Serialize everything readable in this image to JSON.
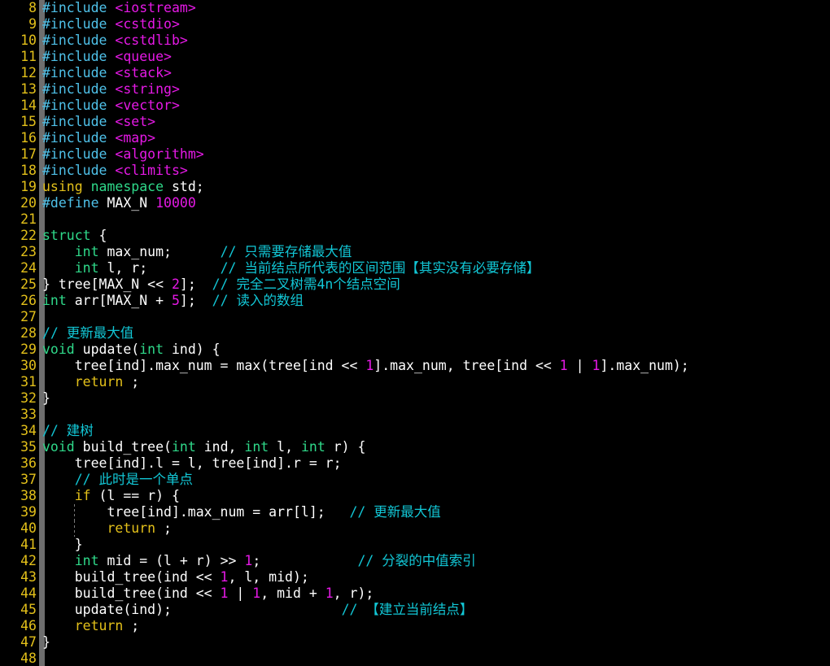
{
  "editor": {
    "title": "segment-tree-source",
    "language": "C++",
    "first_visible_line": 8,
    "last_visible_line": 48,
    "line_height_px": 20,
    "colors": {
      "background": "#000000",
      "gutter_bar": "#6e6e6e",
      "line_number": "#e3c01a",
      "preprocessor": "#4fc1e9",
      "header_name": "#e619e6",
      "keyword": "#e3c01a",
      "type": "#2fd98a",
      "number": "#e619e6",
      "comment": "#12c7d6",
      "plain_text": "#ffffff",
      "indent_guide": "#7a7a7a"
    }
  },
  "lines": [
    {
      "n": "8",
      "indent_guides": [],
      "tokens": [
        {
          "c": "t-pre",
          "t": "#include"
        },
        {
          "c": "t-plain",
          "t": " "
        },
        {
          "c": "t-hdr",
          "t": "<iostream>"
        }
      ]
    },
    {
      "n": "9",
      "indent_guides": [],
      "tokens": [
        {
          "c": "t-pre",
          "t": "#include"
        },
        {
          "c": "t-plain",
          "t": " "
        },
        {
          "c": "t-hdr",
          "t": "<cstdio>"
        }
      ]
    },
    {
      "n": "10",
      "indent_guides": [],
      "tokens": [
        {
          "c": "t-pre",
          "t": "#include"
        },
        {
          "c": "t-plain",
          "t": " "
        },
        {
          "c": "t-hdr",
          "t": "<cstdlib>"
        }
      ]
    },
    {
      "n": "11",
      "indent_guides": [],
      "tokens": [
        {
          "c": "t-pre",
          "t": "#include"
        },
        {
          "c": "t-plain",
          "t": " "
        },
        {
          "c": "t-hdr",
          "t": "<queue>"
        }
      ]
    },
    {
      "n": "12",
      "indent_guides": [],
      "tokens": [
        {
          "c": "t-pre",
          "t": "#include"
        },
        {
          "c": "t-plain",
          "t": " "
        },
        {
          "c": "t-hdr",
          "t": "<stack>"
        }
      ]
    },
    {
      "n": "13",
      "indent_guides": [],
      "tokens": [
        {
          "c": "t-pre",
          "t": "#include"
        },
        {
          "c": "t-plain",
          "t": " "
        },
        {
          "c": "t-hdr",
          "t": "<string>"
        }
      ]
    },
    {
      "n": "14",
      "indent_guides": [],
      "tokens": [
        {
          "c": "t-pre",
          "t": "#include"
        },
        {
          "c": "t-plain",
          "t": " "
        },
        {
          "c": "t-hdr",
          "t": "<vector>"
        }
      ]
    },
    {
      "n": "15",
      "indent_guides": [],
      "tokens": [
        {
          "c": "t-pre",
          "t": "#include"
        },
        {
          "c": "t-plain",
          "t": " "
        },
        {
          "c": "t-hdr",
          "t": "<set>"
        }
      ]
    },
    {
      "n": "16",
      "indent_guides": [],
      "tokens": [
        {
          "c": "t-pre",
          "t": "#include"
        },
        {
          "c": "t-plain",
          "t": " "
        },
        {
          "c": "t-hdr",
          "t": "<map>"
        }
      ]
    },
    {
      "n": "17",
      "indent_guides": [],
      "tokens": [
        {
          "c": "t-pre",
          "t": "#include"
        },
        {
          "c": "t-plain",
          "t": " "
        },
        {
          "c": "t-hdr",
          "t": "<algorithm>"
        }
      ]
    },
    {
      "n": "18",
      "indent_guides": [],
      "tokens": [
        {
          "c": "t-pre",
          "t": "#include"
        },
        {
          "c": "t-plain",
          "t": " "
        },
        {
          "c": "t-hdr",
          "t": "<climits>"
        }
      ]
    },
    {
      "n": "19",
      "indent_guides": [],
      "tokens": [
        {
          "c": "t-kw",
          "t": "using"
        },
        {
          "c": "t-plain",
          "t": " "
        },
        {
          "c": "t-type",
          "t": "namespace"
        },
        {
          "c": "t-plain",
          "t": " std;"
        }
      ]
    },
    {
      "n": "20",
      "indent_guides": [],
      "tokens": [
        {
          "c": "t-pre",
          "t": "#define"
        },
        {
          "c": "t-plain",
          "t": " MAX_N "
        },
        {
          "c": "t-num",
          "t": "10000"
        }
      ]
    },
    {
      "n": "21",
      "indent_guides": [],
      "tokens": []
    },
    {
      "n": "22",
      "indent_guides": [],
      "tokens": [
        {
          "c": "t-type",
          "t": "struct"
        },
        {
          "c": "t-plain",
          "t": " {"
        }
      ]
    },
    {
      "n": "23",
      "indent_guides": [],
      "tokens": [
        {
          "c": "t-plain",
          "t": "    "
        },
        {
          "c": "t-type",
          "t": "int"
        },
        {
          "c": "t-plain",
          "t": " max_num;      "
        },
        {
          "c": "t-cmt",
          "t": "// 只需要存储最大值"
        }
      ]
    },
    {
      "n": "24",
      "indent_guides": [],
      "tokens": [
        {
          "c": "t-plain",
          "t": "    "
        },
        {
          "c": "t-type",
          "t": "int"
        },
        {
          "c": "t-plain",
          "t": " l, r;         "
        },
        {
          "c": "t-cmt",
          "t": "// 当前结点所代表的区间范围【其实没有必要存储】"
        }
      ]
    },
    {
      "n": "25",
      "indent_guides": [],
      "tokens": [
        {
          "c": "t-plain",
          "t": "} tree[MAX_N << "
        },
        {
          "c": "t-num",
          "t": "2"
        },
        {
          "c": "t-plain",
          "t": "];  "
        },
        {
          "c": "t-cmt",
          "t": "// 完全二叉树需4n个结点空间"
        }
      ]
    },
    {
      "n": "26",
      "indent_guides": [],
      "tokens": [
        {
          "c": "t-type",
          "t": "int"
        },
        {
          "c": "t-plain",
          "t": " arr[MAX_N + "
        },
        {
          "c": "t-num",
          "t": "5"
        },
        {
          "c": "t-plain",
          "t": "];  "
        },
        {
          "c": "t-cmt",
          "t": "// 读入的数组"
        }
      ]
    },
    {
      "n": "27",
      "indent_guides": [],
      "tokens": []
    },
    {
      "n": "28",
      "indent_guides": [],
      "tokens": [
        {
          "c": "t-cmt",
          "t": "// 更新最大值"
        }
      ]
    },
    {
      "n": "29",
      "indent_guides": [],
      "tokens": [
        {
          "c": "t-type",
          "t": "void"
        },
        {
          "c": "t-plain",
          "t": " update("
        },
        {
          "c": "t-type",
          "t": "int"
        },
        {
          "c": "t-plain",
          "t": " ind) {"
        }
      ]
    },
    {
      "n": "30",
      "indent_guides": [],
      "tokens": [
        {
          "c": "t-plain",
          "t": "    tree[ind].max_num = max(tree[ind << "
        },
        {
          "c": "t-num",
          "t": "1"
        },
        {
          "c": "t-plain",
          "t": "].max_num, tree[ind << "
        },
        {
          "c": "t-num",
          "t": "1"
        },
        {
          "c": "t-plain",
          "t": " | "
        },
        {
          "c": "t-num",
          "t": "1"
        },
        {
          "c": "t-plain",
          "t": "].max_num);"
        }
      ]
    },
    {
      "n": "31",
      "indent_guides": [],
      "tokens": [
        {
          "c": "t-plain",
          "t": "    "
        },
        {
          "c": "t-kw",
          "t": "return"
        },
        {
          "c": "t-plain",
          "t": " ;"
        }
      ]
    },
    {
      "n": "32",
      "indent_guides": [],
      "tokens": [
        {
          "c": "t-plain",
          "t": "}"
        }
      ]
    },
    {
      "n": "33",
      "indent_guides": [],
      "tokens": []
    },
    {
      "n": "34",
      "indent_guides": [],
      "tokens": [
        {
          "c": "t-cmt",
          "t": "// 建树"
        }
      ]
    },
    {
      "n": "35",
      "indent_guides": [],
      "tokens": [
        {
          "c": "t-type",
          "t": "void"
        },
        {
          "c": "t-plain",
          "t": " build_tree("
        },
        {
          "c": "t-type",
          "t": "int"
        },
        {
          "c": "t-plain",
          "t": " ind, "
        },
        {
          "c": "t-type",
          "t": "int"
        },
        {
          "c": "t-plain",
          "t": " l, "
        },
        {
          "c": "t-type",
          "t": "int"
        },
        {
          "c": "t-plain",
          "t": " r) {"
        }
      ]
    },
    {
      "n": "36",
      "indent_guides": [],
      "tokens": [
        {
          "c": "t-plain",
          "t": "    tree[ind].l = l, tree[ind].r = r;"
        }
      ]
    },
    {
      "n": "37",
      "indent_guides": [],
      "tokens": [
        {
          "c": "t-plain",
          "t": "    "
        },
        {
          "c": "t-cmt",
          "t": "// 此时是一个单点"
        }
      ]
    },
    {
      "n": "38",
      "indent_guides": [],
      "tokens": [
        {
          "c": "t-plain",
          "t": "    "
        },
        {
          "c": "t-kw",
          "t": "if"
        },
        {
          "c": "t-plain",
          "t": " (l == r) {"
        }
      ]
    },
    {
      "n": "39",
      "indent_guides": [
        91
      ],
      "tokens": [
        {
          "c": "t-plain",
          "t": "        tree[ind].max_num = arr[l];   "
        },
        {
          "c": "t-cmt",
          "t": "// 更新最大值"
        }
      ]
    },
    {
      "n": "40",
      "indent_guides": [
        91
      ],
      "tokens": [
        {
          "c": "t-plain",
          "t": "        "
        },
        {
          "c": "t-kw",
          "t": "return"
        },
        {
          "c": "t-plain",
          "t": " ;"
        }
      ]
    },
    {
      "n": "41",
      "indent_guides": [],
      "tokens": [
        {
          "c": "t-plain",
          "t": "    }"
        }
      ]
    },
    {
      "n": "42",
      "indent_guides": [],
      "tokens": [
        {
          "c": "t-plain",
          "t": "    "
        },
        {
          "c": "t-type",
          "t": "int"
        },
        {
          "c": "t-plain",
          "t": " mid = (l + r) >> "
        },
        {
          "c": "t-num",
          "t": "1"
        },
        {
          "c": "t-plain",
          "t": ";            "
        },
        {
          "c": "t-cmt",
          "t": "// 分裂的中值索引"
        }
      ]
    },
    {
      "n": "43",
      "indent_guides": [],
      "tokens": [
        {
          "c": "t-plain",
          "t": "    build_tree(ind << "
        },
        {
          "c": "t-num",
          "t": "1"
        },
        {
          "c": "t-plain",
          "t": ", l, mid);"
        }
      ]
    },
    {
      "n": "44",
      "indent_guides": [],
      "tokens": [
        {
          "c": "t-plain",
          "t": "    build_tree(ind << "
        },
        {
          "c": "t-num",
          "t": "1"
        },
        {
          "c": "t-plain",
          "t": " | "
        },
        {
          "c": "t-num",
          "t": "1"
        },
        {
          "c": "t-plain",
          "t": ", mid + "
        },
        {
          "c": "t-num",
          "t": "1"
        },
        {
          "c": "t-plain",
          "t": ", r);"
        }
      ]
    },
    {
      "n": "45",
      "indent_guides": [],
      "tokens": [
        {
          "c": "t-plain",
          "t": "    update(ind);                     "
        },
        {
          "c": "t-cmt",
          "t": "// 【建立当前结点】"
        }
      ]
    },
    {
      "n": "46",
      "indent_guides": [],
      "tokens": [
        {
          "c": "t-plain",
          "t": "    "
        },
        {
          "c": "t-kw",
          "t": "return"
        },
        {
          "c": "t-plain",
          "t": " ;"
        }
      ]
    },
    {
      "n": "47",
      "indent_guides": [],
      "tokens": [
        {
          "c": "t-plain",
          "t": "}"
        }
      ]
    },
    {
      "n": "48",
      "indent_guides": [],
      "tokens": []
    }
  ]
}
